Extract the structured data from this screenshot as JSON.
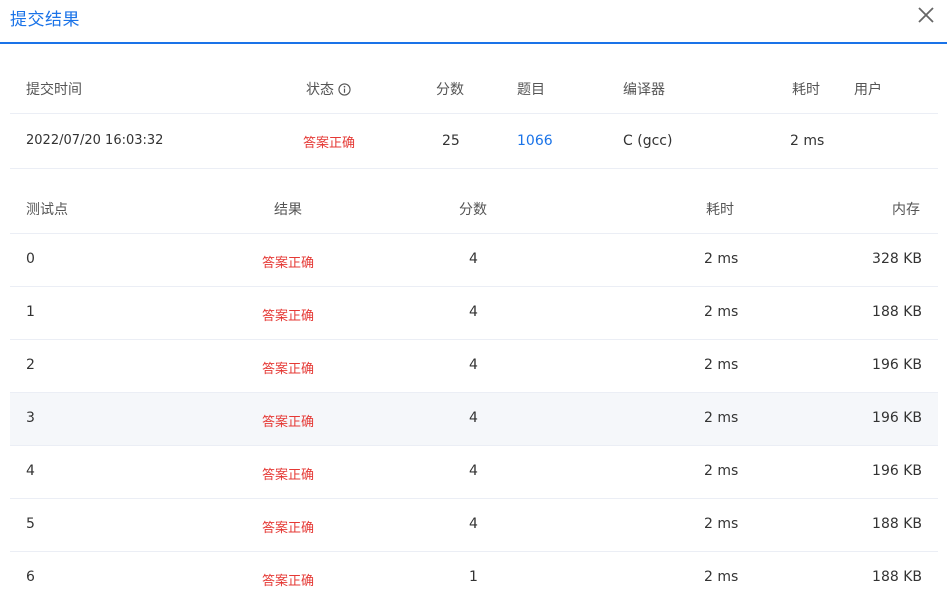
{
  "dialog": {
    "title": "提交结果",
    "close_icon": "close-icon"
  },
  "submission": {
    "headers": {
      "time": "提交时间",
      "status": "状态",
      "score": "分数",
      "problem": "题目",
      "compiler": "编译器",
      "elapsed": "耗时",
      "user": "用户"
    },
    "row": {
      "time": "2022/07/20 16:03:32",
      "status": "答案正确",
      "score": "25",
      "problem": "1066",
      "compiler": "C (gcc)",
      "elapsed": "2 ms",
      "user": ""
    }
  },
  "testcases": {
    "headers": {
      "id": "测试点",
      "result": "结果",
      "score": "分数",
      "elapsed": "耗时",
      "memory": "内存"
    },
    "rows": [
      {
        "id": "0",
        "result": "答案正确",
        "score": "4",
        "elapsed": "2 ms",
        "memory": "328 KB"
      },
      {
        "id": "1",
        "result": "答案正确",
        "score": "4",
        "elapsed": "2 ms",
        "memory": "188 KB"
      },
      {
        "id": "2",
        "result": "答案正确",
        "score": "4",
        "elapsed": "2 ms",
        "memory": "196 KB"
      },
      {
        "id": "3",
        "result": "答案正确",
        "score": "4",
        "elapsed": "2 ms",
        "memory": "196 KB"
      },
      {
        "id": "4",
        "result": "答案正确",
        "score": "4",
        "elapsed": "2 ms",
        "memory": "196 KB"
      },
      {
        "id": "5",
        "result": "答案正确",
        "score": "4",
        "elapsed": "2 ms",
        "memory": "188 KB"
      },
      {
        "id": "6",
        "result": "答案正确",
        "score": "1",
        "elapsed": "2 ms",
        "memory": "188 KB"
      }
    ]
  }
}
